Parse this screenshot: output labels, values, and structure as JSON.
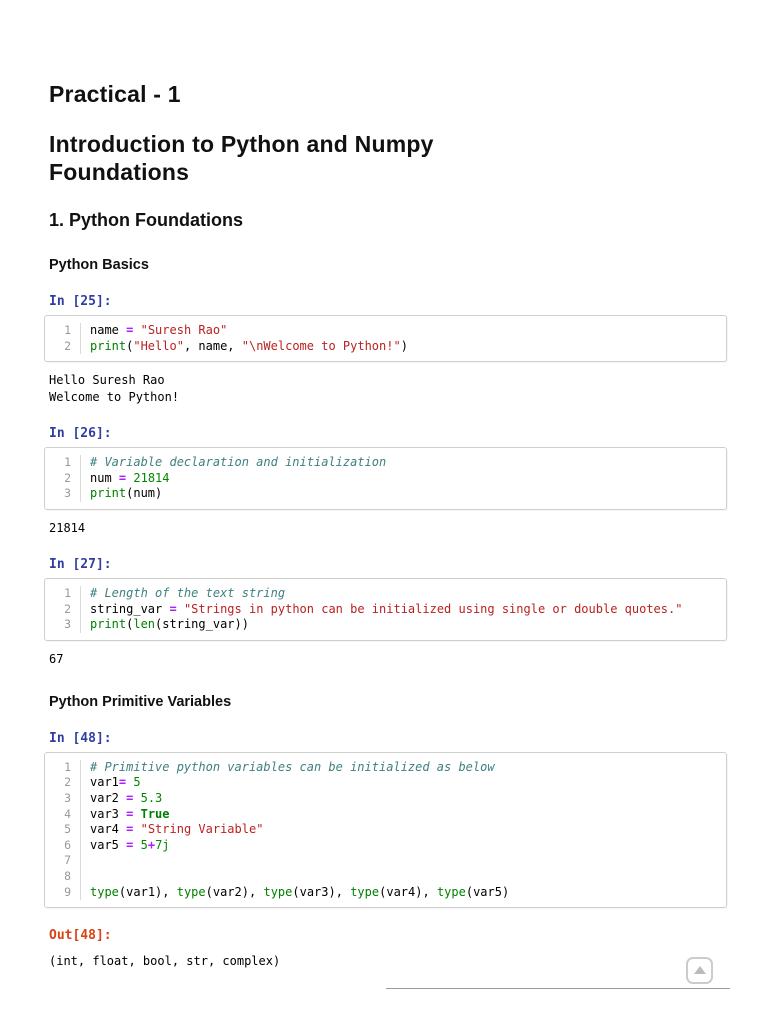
{
  "headings": {
    "title1": "Practical - 1",
    "title2": "Introduction to Python and Numpy Foundations",
    "section": "1. Python Foundations"
  },
  "colors": {
    "prompt_in": "#303F9F",
    "prompt_out": "#D84315",
    "keyword": "#008000",
    "builtin": "#008000",
    "string": "#BA2121",
    "number": "#008800",
    "operator": "#AA22FF",
    "comment": "#408080",
    "cell_border": "#cfcfcf",
    "line_number": "#999999"
  },
  "notebook": {
    "blocks": [
      {
        "type": "h3",
        "text": "Python Basics"
      },
      {
        "type": "cell",
        "prompt": "In [25]:",
        "lines": [
          [
            {
              "c": "n",
              "t": "name "
            },
            {
              "c": "o",
              "t": "="
            },
            {
              "c": "p",
              "t": " "
            },
            {
              "c": "s",
              "t": "\"Suresh Rao\""
            }
          ],
          [
            {
              "c": "b",
              "t": "print"
            },
            {
              "c": "p",
              "t": "("
            },
            {
              "c": "s",
              "t": "\"Hello\""
            },
            {
              "c": "p",
              "t": ", "
            },
            {
              "c": "n",
              "t": "name"
            },
            {
              "c": "p",
              "t": ", "
            },
            {
              "c": "s",
              "t": "\"\\nWelcome to Python!\""
            },
            {
              "c": "p",
              "t": ")"
            }
          ]
        ],
        "stream_output": [
          "Hello Suresh Rao",
          "Welcome to Python!"
        ]
      },
      {
        "type": "cell",
        "prompt": "In [26]:",
        "lines": [
          [
            {
              "c": "c",
              "t": "# Variable declaration and initialization"
            }
          ],
          [
            {
              "c": "n",
              "t": "num "
            },
            {
              "c": "o",
              "t": "="
            },
            {
              "c": "p",
              "t": " "
            },
            {
              "c": "m",
              "t": "21814"
            }
          ],
          [
            {
              "c": "b",
              "t": "print"
            },
            {
              "c": "p",
              "t": "("
            },
            {
              "c": "n",
              "t": "num"
            },
            {
              "c": "p",
              "t": ")"
            }
          ]
        ],
        "stream_output": [
          "21814"
        ]
      },
      {
        "type": "cell",
        "prompt": "In [27]:",
        "lines": [
          [
            {
              "c": "c",
              "t": "# Length of the text string"
            }
          ],
          [
            {
              "c": "n",
              "t": "string_var "
            },
            {
              "c": "o",
              "t": "="
            },
            {
              "c": "p",
              "t": " "
            },
            {
              "c": "s",
              "t": "\"Strings in python can be initialized using single or double quotes.\""
            }
          ],
          [
            {
              "c": "b",
              "t": "print"
            },
            {
              "c": "p",
              "t": "("
            },
            {
              "c": "b",
              "t": "len"
            },
            {
              "c": "p",
              "t": "("
            },
            {
              "c": "n",
              "t": "string_var"
            },
            {
              "c": "p",
              "t": "))"
            }
          ]
        ],
        "stream_output": [
          "67"
        ]
      },
      {
        "type": "h3",
        "text": "Python Primitive Variables"
      },
      {
        "type": "cell",
        "prompt": "In [48]:",
        "lines": [
          [
            {
              "c": "c",
              "t": "# Primitive python variables can be initialized as below"
            }
          ],
          [
            {
              "c": "n",
              "t": "var1"
            },
            {
              "c": "o",
              "t": "="
            },
            {
              "c": "p",
              "t": " "
            },
            {
              "c": "m",
              "t": "5"
            }
          ],
          [
            {
              "c": "n",
              "t": "var2 "
            },
            {
              "c": "o",
              "t": "="
            },
            {
              "c": "p",
              "t": " "
            },
            {
              "c": "m",
              "t": "5.3"
            }
          ],
          [
            {
              "c": "n",
              "t": "var3 "
            },
            {
              "c": "o",
              "t": "="
            },
            {
              "c": "p",
              "t": " "
            },
            {
              "c": "k",
              "t": "True"
            }
          ],
          [
            {
              "c": "n",
              "t": "var4 "
            },
            {
              "c": "o",
              "t": "="
            },
            {
              "c": "p",
              "t": " "
            },
            {
              "c": "s",
              "t": "\"String Variable\""
            }
          ],
          [
            {
              "c": "n",
              "t": "var5 "
            },
            {
              "c": "o",
              "t": "="
            },
            {
              "c": "p",
              "t": " "
            },
            {
              "c": "m",
              "t": "5"
            },
            {
              "c": "o",
              "t": "+"
            },
            {
              "c": "m",
              "t": "7j"
            }
          ],
          [],
          [],
          [
            {
              "c": "b",
              "t": "type"
            },
            {
              "c": "p",
              "t": "("
            },
            {
              "c": "n",
              "t": "var1"
            },
            {
              "c": "p",
              "t": "), "
            },
            {
              "c": "b",
              "t": "type"
            },
            {
              "c": "p",
              "t": "("
            },
            {
              "c": "n",
              "t": "var2"
            },
            {
              "c": "p",
              "t": "), "
            },
            {
              "c": "b",
              "t": "type"
            },
            {
              "c": "p",
              "t": "("
            },
            {
              "c": "n",
              "t": "var3"
            },
            {
              "c": "p",
              "t": "), "
            },
            {
              "c": "b",
              "t": "type"
            },
            {
              "c": "p",
              "t": "("
            },
            {
              "c": "n",
              "t": "var4"
            },
            {
              "c": "p",
              "t": "), "
            },
            {
              "c": "b",
              "t": "type"
            },
            {
              "c": "p",
              "t": "("
            },
            {
              "c": "n",
              "t": "var5"
            },
            {
              "c": "p",
              "t": ")"
            }
          ]
        ],
        "output_prompt": "Out[48]:",
        "result_output": [
          "(int, float, bool, str, complex)"
        ]
      }
    ]
  },
  "footer": {
    "scroll_top_icon": "up-arrow-icon"
  }
}
